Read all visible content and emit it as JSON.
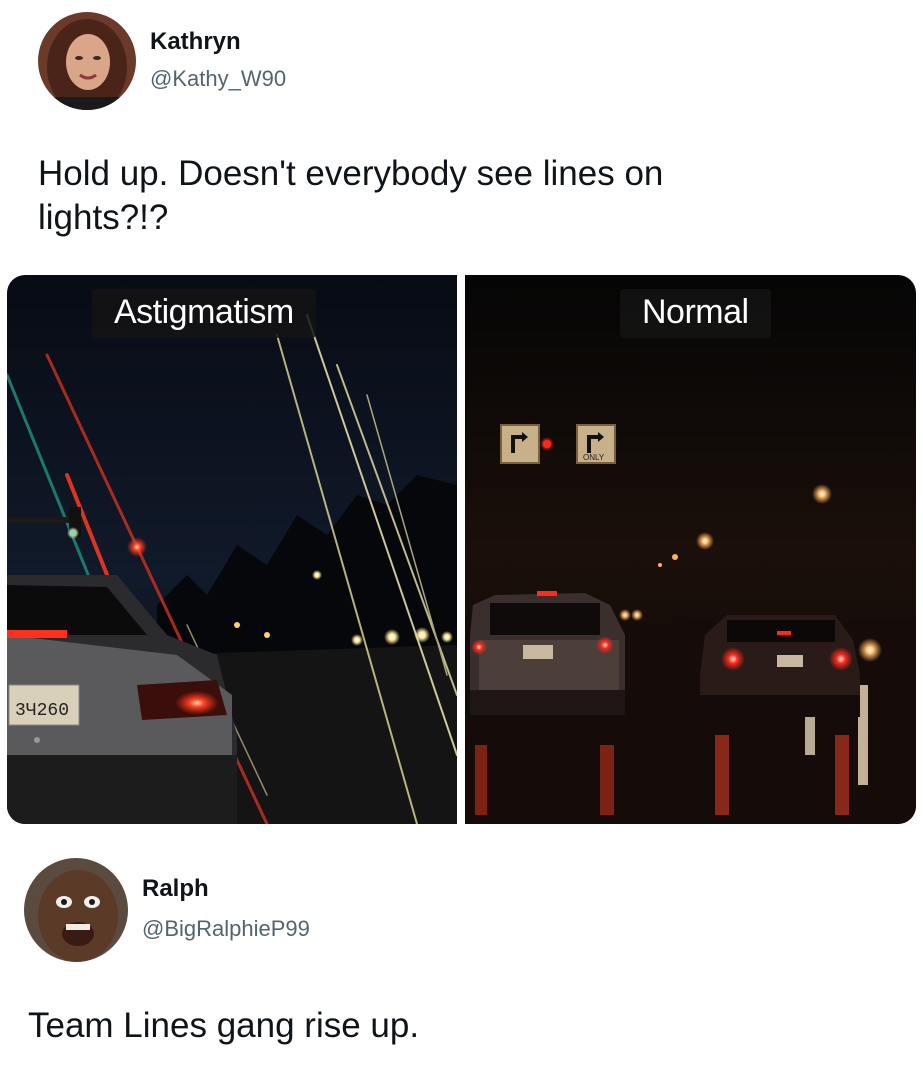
{
  "tweet1": {
    "display_name": "Kathryn",
    "handle": "@Kathy_W90",
    "text_line1": "Hold up. Doesn't everybody see lines on",
    "text_line2": "lights?!?",
    "avatar_icon": "woman-avatar-photo"
  },
  "media": {
    "left_label": "Astigmatism",
    "right_label": "Normal",
    "left_plate": "3Ч260",
    "right_sign_text": "ONLY"
  },
  "tweet2": {
    "display_name": "Ralph",
    "handle": "@BigRalphieP99",
    "text": "Team Lines gang rise up.",
    "avatar_icon": "man-avatar-photo"
  }
}
